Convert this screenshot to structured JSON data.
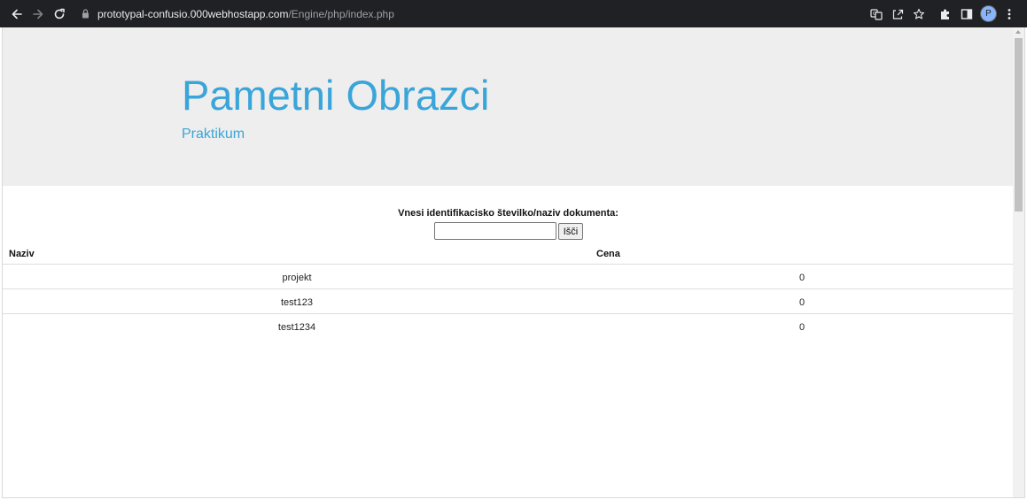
{
  "browser": {
    "url_host": "prototypal-confusio.000webhostapp.com",
    "url_path": "/Engine/php/index.php",
    "profile_initial": "P",
    "icons": {
      "back": "arrow-left-icon",
      "forward": "arrow-right-icon",
      "reload": "reload-icon",
      "lock": "lock-icon",
      "translate": "translate-icon",
      "share": "share-icon",
      "bookmark": "star-icon",
      "extensions": "puzzle-icon",
      "side_panel": "side-panel-icon",
      "menu": "kebab-menu-icon"
    }
  },
  "header": {
    "title": "Pametni Obrazci",
    "subtitle": "Praktikum"
  },
  "search": {
    "label": "Vnesi identifikacisko številko/naziv dokumenta:",
    "value": "",
    "button": "Išči"
  },
  "table": {
    "columns": [
      "Naziv",
      "Cena"
    ],
    "rows": [
      {
        "naziv": "projekt",
        "cena": "0"
      },
      {
        "naziv": "test123",
        "cena": "0"
      },
      {
        "naziv": "test1234",
        "cena": "0"
      }
    ]
  },
  "colors": {
    "accent": "#3aa5d9",
    "jumbotron": "#eeeeee",
    "chrome": "#202124"
  }
}
